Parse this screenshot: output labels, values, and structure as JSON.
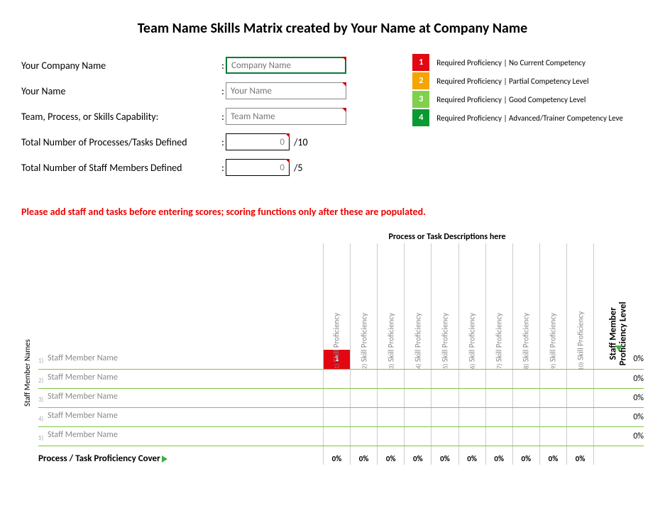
{
  "title": "Team Name Skills Matrix created by Your Name at Company Name",
  "form": {
    "company_label": "Your Company Name",
    "company_placeholder": "Company Name",
    "name_label": "Your Name",
    "name_placeholder": "Your Name",
    "team_label": "Team, Process, or Skills Capability:",
    "team_placeholder": "Team Name",
    "tasks_label": "Total Number of Processes/Tasks Defined",
    "tasks_value": "0",
    "tasks_suffix": "/10",
    "staff_label": "Total Number of Staff Members Defined",
    "staff_value": "0",
    "staff_suffix": "/5"
  },
  "legend": [
    {
      "num": "1",
      "color": "#e30613",
      "text": "Required Proficiency | No Current Competency"
    },
    {
      "num": "2",
      "color": "#f5a400",
      "text": "Required Proficiency | Partial Competency Level"
    },
    {
      "num": "3",
      "color": "#7fd04a",
      "text": "Required Proficiency | Good Competency Level"
    },
    {
      "num": "4",
      "color": "#0a9a33",
      "text": "Required Proficiency | Advanced/Trainer Competency Leve"
    }
  ],
  "warning": "Please add staff and tasks before entering scores; scoring functions only after these are populated.",
  "task_header": "Process or Task Descriptions here",
  "side_label": "Staff Member Names",
  "prof_level_label": "Staff Member\nProficiency Level",
  "columns": [
    {
      "idx": "1)",
      "label": "Skill Proficiency"
    },
    {
      "idx": "2)",
      "label": "Skill Proficiency"
    },
    {
      "idx": "3)",
      "label": "Skill Proficiency"
    },
    {
      "idx": "4)",
      "label": "Skill Proficiency"
    },
    {
      "idx": "5)",
      "label": "Skill Proficiency"
    },
    {
      "idx": "6)",
      "label": "Skill Proficiency"
    },
    {
      "idx": "7)",
      "label": "Skill Proficiency"
    },
    {
      "idx": "8)",
      "label": "Skill Proficiency"
    },
    {
      "idx": "9)",
      "label": "Skill Proficiency"
    },
    {
      "idx": "10)",
      "label": "Skill Proficiency"
    }
  ],
  "rows": [
    {
      "idx": "1)",
      "name": "Staff Member Name",
      "cells": [
        "1",
        "",
        "",
        "",
        "",
        "",
        "",
        "",
        "",
        ""
      ],
      "prof": "0%"
    },
    {
      "idx": "2)",
      "name": "Staff Member Name",
      "cells": [
        "",
        "",
        "",
        "",
        "",
        "",
        "",
        "",
        "",
        ""
      ],
      "prof": "0%"
    },
    {
      "idx": "3)",
      "name": "Staff Member Name",
      "cells": [
        "",
        "",
        "",
        "",
        "",
        "",
        "",
        "",
        "",
        ""
      ],
      "prof": "0%"
    },
    {
      "idx": "4)",
      "name": "Staff Member Name",
      "cells": [
        "",
        "",
        "",
        "",
        "",
        "",
        "",
        "",
        "",
        ""
      ],
      "prof": "0%"
    },
    {
      "idx": "5)",
      "name": "Staff Member Name",
      "cells": [
        "",
        "",
        "",
        "",
        "",
        "",
        "",
        "",
        "",
        ""
      ],
      "prof": "0%"
    }
  ],
  "footer": {
    "label": "Process / Task Proficiency Cover",
    "values": [
      "0%",
      "0%",
      "0%",
      "0%",
      "0%",
      "0%",
      "0%",
      "0%",
      "0%",
      "0%"
    ]
  }
}
